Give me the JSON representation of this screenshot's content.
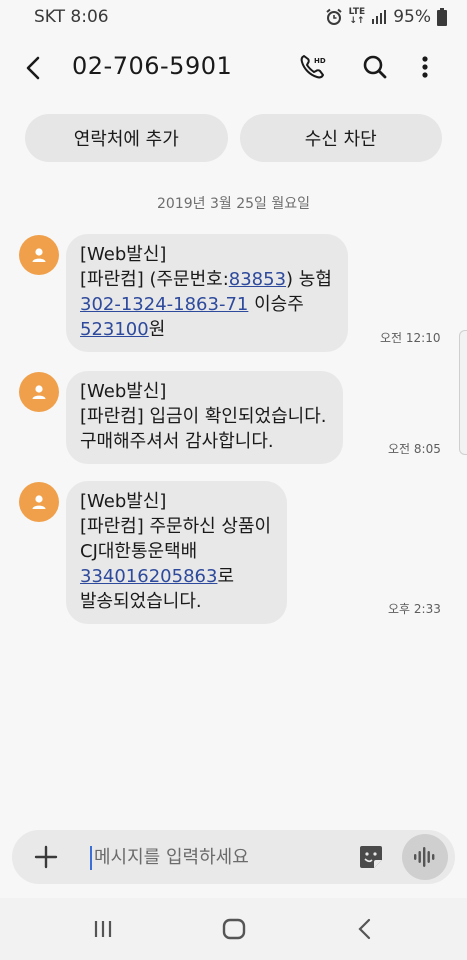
{
  "status": {
    "carrier_time": "SKT 8:06",
    "battery": "95%",
    "network": "LTE"
  },
  "header": {
    "title": "02-706-5901"
  },
  "actions": {
    "add_contact": "연락처에 추가",
    "block": "수신 차단"
  },
  "date_separator": "2019년 3월 25일 월요일",
  "messages": [
    {
      "time": "오전 12:10",
      "lines": [
        [
          {
            "t": "[Web발신]"
          }
        ],
        [
          {
            "t": "[파란컴] (주문번호:"
          },
          {
            "t": "83853",
            "link": true
          },
          {
            "t": ") 농협"
          }
        ],
        [
          {
            "t": "302-1324-1863-71",
            "link": true
          },
          {
            "t": " 이승주"
          }
        ],
        [
          {
            "t": "523100",
            "link": true
          },
          {
            "t": "원"
          }
        ]
      ]
    },
    {
      "time": "오전 8:05",
      "lines": [
        [
          {
            "t": "[Web발신]"
          }
        ],
        [
          {
            "t": "[파란컴] 입금이 확인되었습니다."
          }
        ],
        [
          {
            "t": "구매해주셔서 감사합니다."
          }
        ]
      ]
    },
    {
      "time": "오후 2:33",
      "lines": [
        [
          {
            "t": "[Web발신]"
          }
        ],
        [
          {
            "t": "[파란컴] 주문하신 상품이"
          }
        ],
        [
          {
            "t": "CJ대한통운택배"
          }
        ],
        [
          {
            "t": "334016205863",
            "link": true
          },
          {
            "t": "로"
          }
        ],
        [
          {
            "t": "발송되었습니다."
          }
        ]
      ]
    }
  ],
  "composer": {
    "placeholder": "메시지를 입력하세요",
    "value": ""
  },
  "icons": {
    "back": "back-arrow-icon",
    "call": "hd-call-icon",
    "search": "search-icon",
    "more": "more-vert-icon",
    "add": "plus-icon",
    "sticker": "sticker-icon",
    "voice": "voice-record-icon",
    "avatar": "person-icon",
    "nav_recent": "recents-icon",
    "nav_home": "home-icon",
    "nav_back": "nav-back-icon"
  },
  "colors": {
    "avatar": "#f0a04a",
    "link": "#2e4a9c",
    "bubble": "#e8e8e8"
  }
}
